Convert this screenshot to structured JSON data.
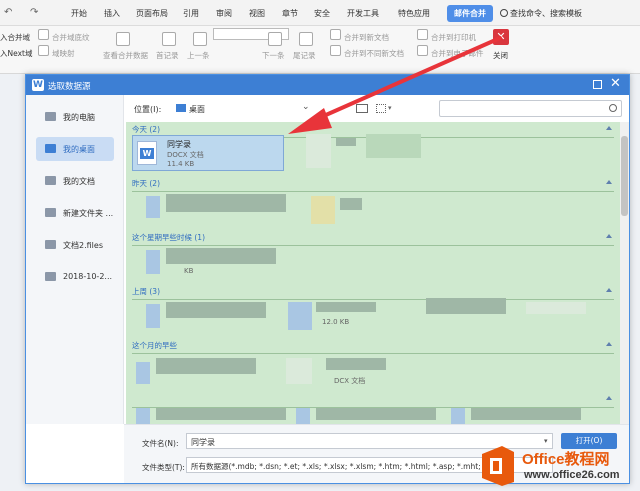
{
  "ribbon": {
    "quick_access": [
      "↶",
      "↷"
    ],
    "tabs": [
      "开始",
      "插入",
      "页面布局",
      "引用",
      "审阅",
      "视图",
      "章节",
      "安全",
      "开发工具",
      "特色应用",
      "邮件合并"
    ],
    "active_tab": "邮件合并",
    "search_label": "查找命令、搜索模板",
    "tools": {
      "merge_domain": "入合并域",
      "merge_domain_disabled": "合并域底纹",
      "insert_next": "入Next域",
      "field_map": "域映射",
      "view_data": "查看合并数据",
      "first_record": "首记录",
      "prev_record": "上一条",
      "next_record": "下一条",
      "last_record": "尾记录",
      "merge_new_doc": "合并到新文档",
      "merge_diff_doc": "合并到不同新文档",
      "merge_printer": "合并到打印机",
      "merge_email": "合并到电子邮件",
      "close": "关闭"
    }
  },
  "dialog": {
    "title": "选取数据源",
    "sidebar": [
      {
        "label": "我的电脑",
        "selected": false
      },
      {
        "label": "我的桌面",
        "selected": true
      },
      {
        "label": "我的文档",
        "selected": false
      },
      {
        "label": "新建文件夹 ...",
        "selected": false
      },
      {
        "label": "文档2.files",
        "selected": false
      },
      {
        "label": "2018-10-2...",
        "selected": false
      }
    ],
    "location_label": "位置(I):",
    "location_value": "桌面",
    "groups": [
      "今天 (2)",
      "昨天 (2)",
      "这个星期早些时候 (1)",
      "上周 (3)",
      "这个月的早些",
      ""
    ],
    "file": {
      "name": "同学录",
      "type": "DOCX 文档",
      "size": "11.4 KB"
    },
    "ghost_texts": [
      "KB",
      "12.0 KB",
      "DCX 文档"
    ],
    "filename_label": "文件名(N):",
    "filename_value": "同学录",
    "filetype_label": "文件类型(T):",
    "filetype_value": "所有数据源(*.mdb; *.dsn; *.et; *.xls; *.xlsx; *.xlsm; *.htm; *.html; *.asp; *.mht; *.mhtml",
    "open_button": "打开(O)"
  },
  "watermark": {
    "brand": "Office教程网",
    "url": "www.office26.com"
  },
  "colors": {
    "accent": "#3d7fd4",
    "selection": "#c9dcf4",
    "highlight": "#cfe9cf",
    "arrow": "#e8343a",
    "brand": "#e8590c"
  }
}
